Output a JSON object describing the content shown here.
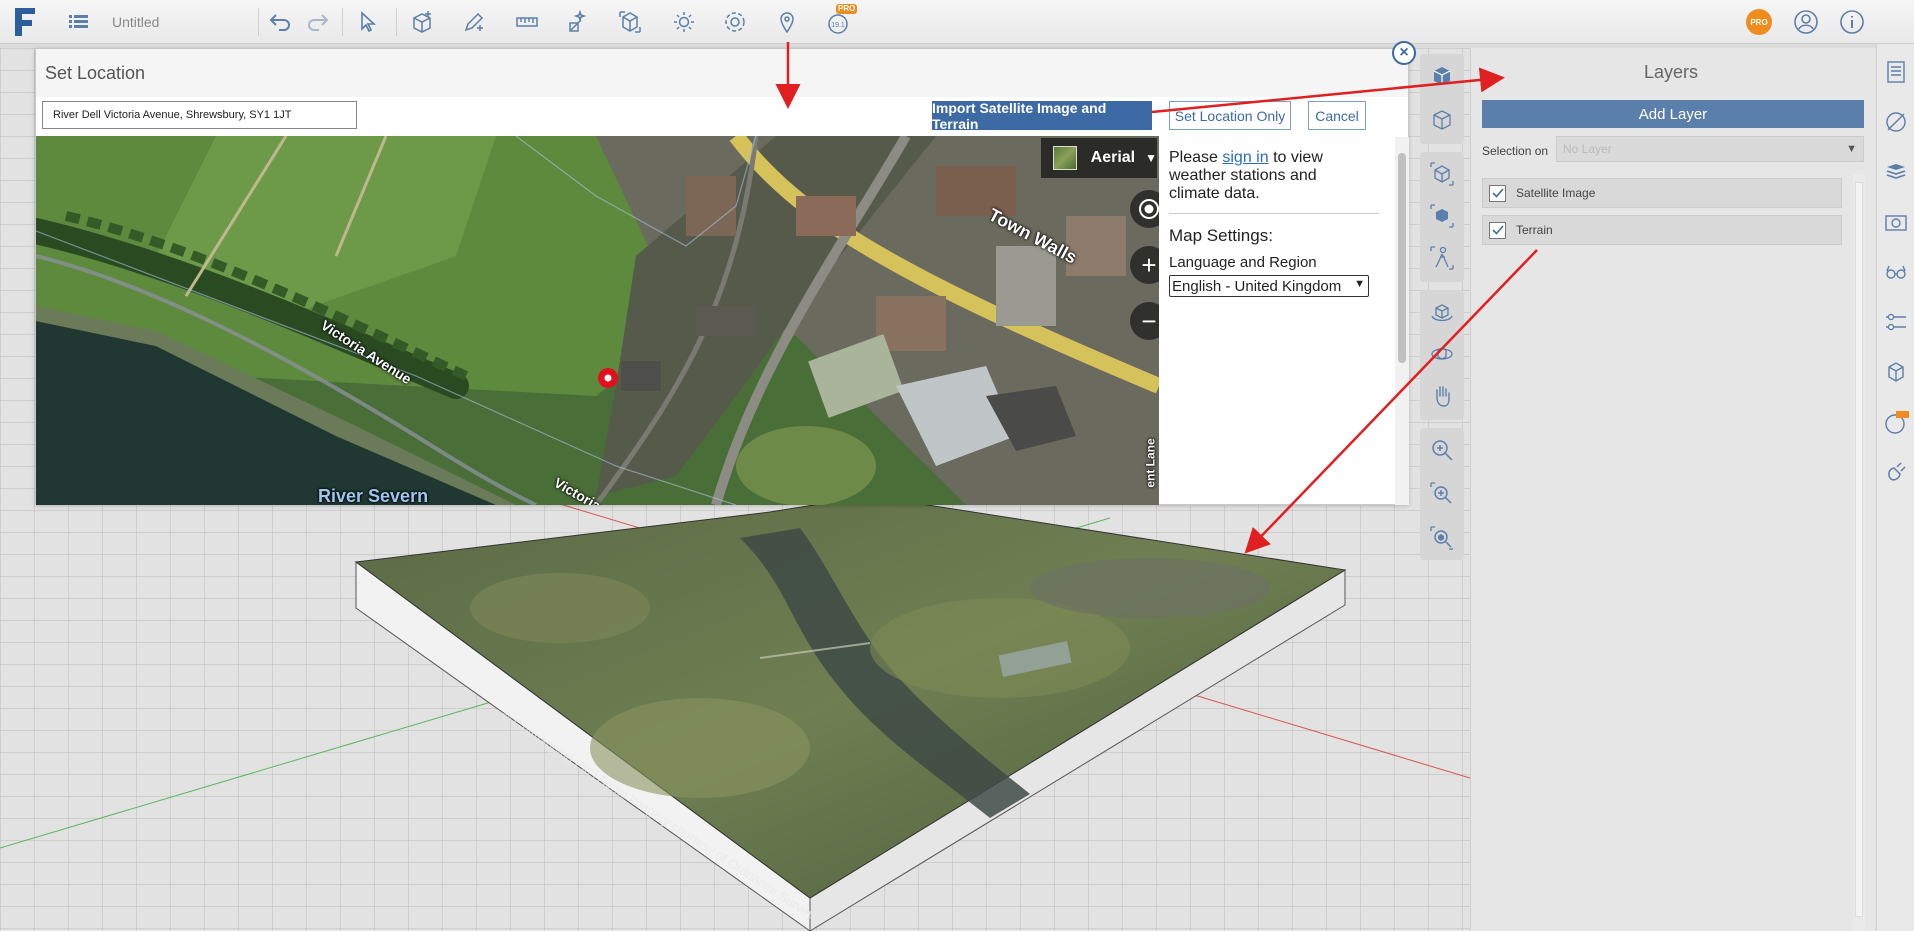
{
  "app": {
    "title": "Untitled",
    "pro_badge": "PRO",
    "version_badge": "19.1",
    "accent": "#3d6aa4"
  },
  "toolbar": {
    "icons": [
      "menu-icon",
      "undo-icon",
      "redo-icon",
      "select-icon",
      "box-icon",
      "pencil-icon",
      "measure-icon",
      "magic-icon",
      "section-icon",
      "sun-icon",
      "settings-icon",
      "location-pin-icon",
      "version-badge-icon"
    ]
  },
  "dialog": {
    "title": "Set Location",
    "close_label": "×",
    "address_value": "River Dell Victoria Avenue, Shrewsbury, SY1 1JT",
    "import_label": "Import Satellite Image and Terrain",
    "set_location_only_label": "Set Location Only",
    "cancel_label": "Cancel",
    "map": {
      "type_label": "Aerial",
      "zoom_in": "+",
      "zoom_out": "−",
      "labels": {
        "victoria_avenue": "Victoria Avenue",
        "victoria_2": "Victoria",
        "town_walls": "Town Walls",
        "river_severn": "River Severn",
        "lane": "ent Lane"
      }
    },
    "info": {
      "please": "Please",
      "sign_in": "sign in",
      "to_view": "to view",
      "line2": "weather stations and",
      "line3": "climate data.",
      "map_settings": "Map Settings:",
      "language_region": "Language and Region",
      "language_value": "English - United Kingdom"
    }
  },
  "layers": {
    "title": "Layers",
    "add_label": "Add Layer",
    "selection_on": "Selection on",
    "selection_placeholder": "No Layer",
    "items": [
      {
        "name": "Satellite Image",
        "checked": true
      },
      {
        "name": "Terrain",
        "checked": true
      }
    ]
  },
  "terrain": {
    "watermark": "© Getmapping Plc | Aerial Imagery courtesy of Ordnance Survey"
  }
}
